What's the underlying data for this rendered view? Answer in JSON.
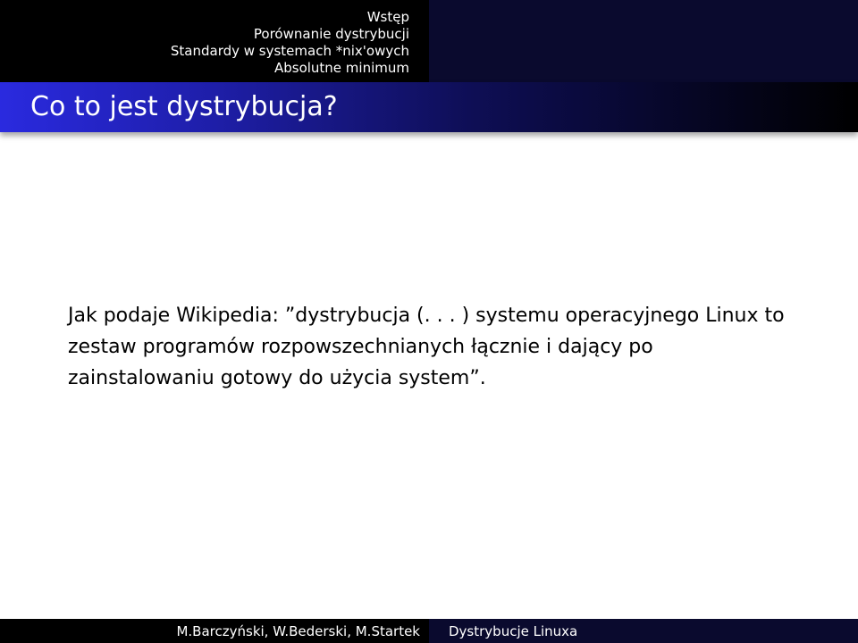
{
  "nav": {
    "sections": [
      "Wstęp",
      "Porównanie dystrybucji",
      "Standardy w systemach *nix'owych",
      "Absolutne minimum"
    ]
  },
  "frame": {
    "title": "Co to jest dystrybucja?"
  },
  "body": {
    "paragraph": "Jak podaje Wikipedia: ”dystrybucja (. . . ) systemu operacyjnego Linux to zestaw programów rozpowszechnianych łącznie i dający po zainstalowaniu gotowy do użycia system”."
  },
  "footer": {
    "authors": "M.Barczyński, W.Bederski, M.Startek",
    "title": "Dystrybucje Linuxa"
  },
  "colors": {
    "nav_background": "#000000",
    "title_gradient_start": "#2a2adf",
    "title_gradient_end": "#000000",
    "text": "#000000"
  }
}
